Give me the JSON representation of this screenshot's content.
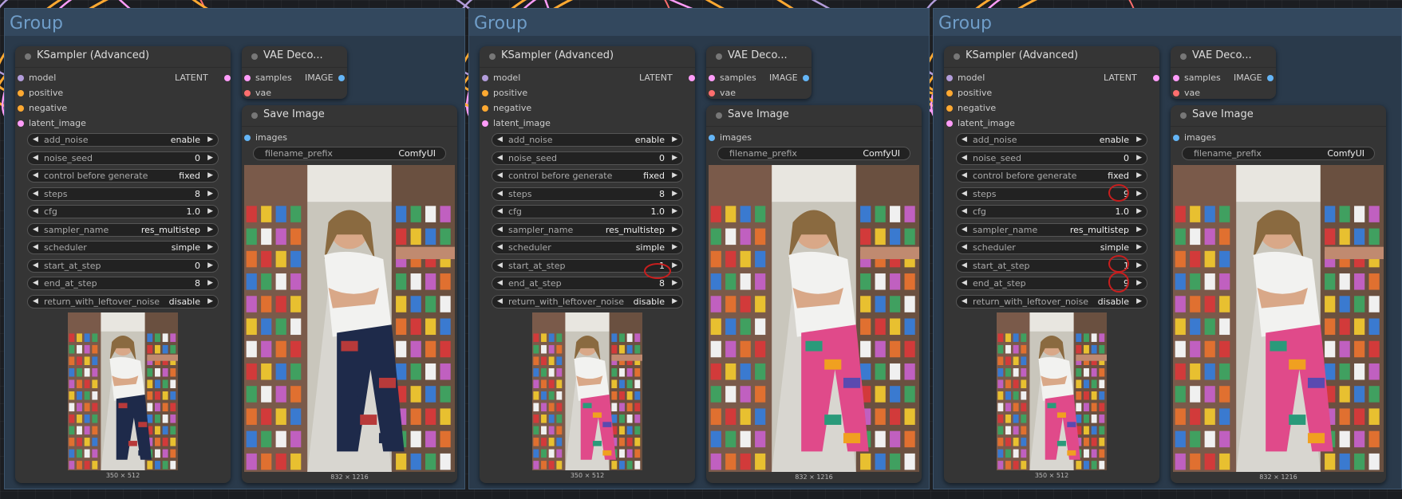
{
  "groups": [
    {
      "title": "Group"
    },
    {
      "title": "Group"
    },
    {
      "title": "Group"
    }
  ],
  "ksampler": [
    {
      "title": "KSampler (Advanced)",
      "output": "LATENT",
      "inputs": [
        "model",
        "positive",
        "negative",
        "latent_image"
      ],
      "widgets": [
        {
          "name": "add_noise",
          "value": "enable"
        },
        {
          "name": "noise_seed",
          "value": "0"
        },
        {
          "name": "control before generate",
          "value": "fixed"
        },
        {
          "name": "steps",
          "value": "8"
        },
        {
          "name": "cfg",
          "value": "1.0"
        },
        {
          "name": "sampler_name",
          "value": "res_multistep"
        },
        {
          "name": "scheduler",
          "value": "simple"
        },
        {
          "name": "start_at_step",
          "value": "0"
        },
        {
          "name": "end_at_step",
          "value": "8"
        },
        {
          "name": "return_with_leftover_noise",
          "value": "disable"
        }
      ],
      "preview_size": "350 × 512"
    },
    {
      "title": "KSampler (Advanced)",
      "output": "LATENT",
      "inputs": [
        "model",
        "positive",
        "negative",
        "latent_image"
      ],
      "widgets": [
        {
          "name": "add_noise",
          "value": "enable"
        },
        {
          "name": "noise_seed",
          "value": "0"
        },
        {
          "name": "control before generate",
          "value": "fixed"
        },
        {
          "name": "steps",
          "value": "8"
        },
        {
          "name": "cfg",
          "value": "1.0"
        },
        {
          "name": "sampler_name",
          "value": "res_multistep"
        },
        {
          "name": "scheduler",
          "value": "simple"
        },
        {
          "name": "start_at_step",
          "value": "1"
        },
        {
          "name": "end_at_step",
          "value": "8"
        },
        {
          "name": "return_with_leftover_noise",
          "value": "disable"
        }
      ],
      "preview_size": "350 × 512"
    },
    {
      "title": "KSampler (Advanced)",
      "output": "LATENT",
      "inputs": [
        "model",
        "positive",
        "negative",
        "latent_image"
      ],
      "widgets": [
        {
          "name": "add_noise",
          "value": "enable"
        },
        {
          "name": "noise_seed",
          "value": "0"
        },
        {
          "name": "control before generate",
          "value": "fixed"
        },
        {
          "name": "steps",
          "value": "9"
        },
        {
          "name": "cfg",
          "value": "1.0"
        },
        {
          "name": "sampler_name",
          "value": "res_multistep"
        },
        {
          "name": "scheduler",
          "value": "simple"
        },
        {
          "name": "start_at_step",
          "value": "1"
        },
        {
          "name": "end_at_step",
          "value": "9"
        },
        {
          "name": "return_with_leftover_noise",
          "value": "disable"
        }
      ],
      "preview_size": "350 × 512"
    }
  ],
  "vae": [
    {
      "title": "VAE Deco...",
      "inputs": [
        "samples",
        "vae"
      ],
      "output": "IMAGE"
    },
    {
      "title": "VAE Deco...",
      "inputs": [
        "samples",
        "vae"
      ],
      "output": "IMAGE"
    },
    {
      "title": "VAE Deco...",
      "inputs": [
        "samples",
        "vae"
      ],
      "output": "IMAGE"
    }
  ],
  "save": [
    {
      "title": "Save Image",
      "input": "images",
      "prefix_name": "filename_prefix",
      "prefix_value": "ComfyUI",
      "image_size": "832 × 1216"
    },
    {
      "title": "Save Image",
      "input": "images",
      "prefix_name": "filename_prefix",
      "prefix_value": "ComfyUI",
      "image_size": "832 × 1216"
    },
    {
      "title": "Save Image",
      "input": "images",
      "prefix_name": "filename_prefix",
      "prefix_value": "ComfyUI",
      "image_size": "832 × 1216"
    }
  ],
  "colors": {
    "model": "#b39ddb",
    "conditioning": "#ffa931",
    "latent": "#ff9cf9",
    "vae": "#ff6e6e",
    "image": "#64b5f6",
    "highlight": "#c81e1e",
    "leggings": [
      "#1e2a4a",
      "#b83a3a"
    ],
    "leggings_patterned": [
      "#e04a8a",
      "#2a9a7a",
      "#f0a020",
      "#5a4ab0"
    ]
  },
  "icons": {
    "arrow_left": "◀",
    "arrow_right": "▶"
  },
  "highlights": [
    "group1.start_at_step",
    "group2.steps",
    "group2.start_at_step",
    "group2.end_at_step"
  ]
}
